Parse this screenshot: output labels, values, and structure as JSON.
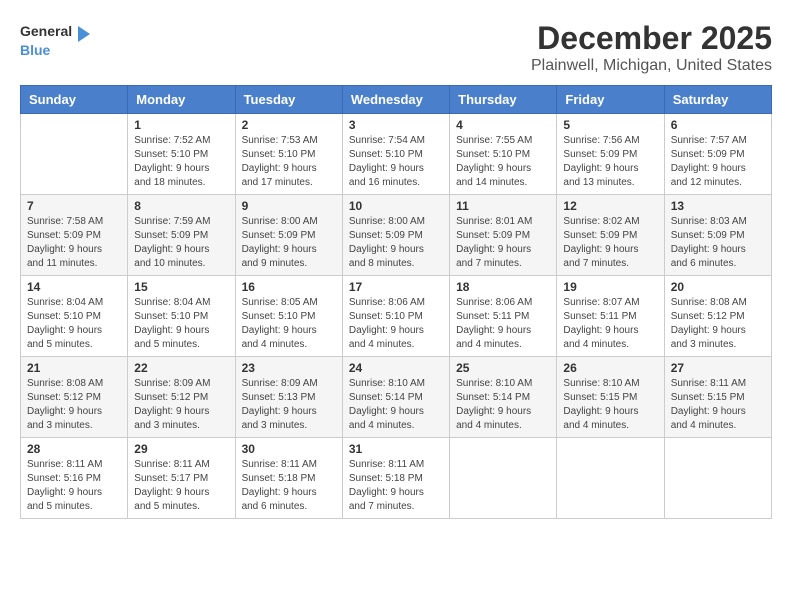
{
  "logo": {
    "text_general": "General",
    "text_blue": "Blue"
  },
  "title": "December 2025",
  "location": "Plainwell, Michigan, United States",
  "weekdays": [
    "Sunday",
    "Monday",
    "Tuesday",
    "Wednesday",
    "Thursday",
    "Friday",
    "Saturday"
  ],
  "weeks": [
    [
      {
        "day": "",
        "info": ""
      },
      {
        "day": "1",
        "info": "Sunrise: 7:52 AM\nSunset: 5:10 PM\nDaylight: 9 hours\nand 18 minutes."
      },
      {
        "day": "2",
        "info": "Sunrise: 7:53 AM\nSunset: 5:10 PM\nDaylight: 9 hours\nand 17 minutes."
      },
      {
        "day": "3",
        "info": "Sunrise: 7:54 AM\nSunset: 5:10 PM\nDaylight: 9 hours\nand 16 minutes."
      },
      {
        "day": "4",
        "info": "Sunrise: 7:55 AM\nSunset: 5:10 PM\nDaylight: 9 hours\nand 14 minutes."
      },
      {
        "day": "5",
        "info": "Sunrise: 7:56 AM\nSunset: 5:09 PM\nDaylight: 9 hours\nand 13 minutes."
      },
      {
        "day": "6",
        "info": "Sunrise: 7:57 AM\nSunset: 5:09 PM\nDaylight: 9 hours\nand 12 minutes."
      }
    ],
    [
      {
        "day": "7",
        "info": "Sunrise: 7:58 AM\nSunset: 5:09 PM\nDaylight: 9 hours\nand 11 minutes."
      },
      {
        "day": "8",
        "info": "Sunrise: 7:59 AM\nSunset: 5:09 PM\nDaylight: 9 hours\nand 10 minutes."
      },
      {
        "day": "9",
        "info": "Sunrise: 8:00 AM\nSunset: 5:09 PM\nDaylight: 9 hours\nand 9 minutes."
      },
      {
        "day": "10",
        "info": "Sunrise: 8:00 AM\nSunset: 5:09 PM\nDaylight: 9 hours\nand 8 minutes."
      },
      {
        "day": "11",
        "info": "Sunrise: 8:01 AM\nSunset: 5:09 PM\nDaylight: 9 hours\nand 7 minutes."
      },
      {
        "day": "12",
        "info": "Sunrise: 8:02 AM\nSunset: 5:09 PM\nDaylight: 9 hours\nand 7 minutes."
      },
      {
        "day": "13",
        "info": "Sunrise: 8:03 AM\nSunset: 5:09 PM\nDaylight: 9 hours\nand 6 minutes."
      }
    ],
    [
      {
        "day": "14",
        "info": "Sunrise: 8:04 AM\nSunset: 5:10 PM\nDaylight: 9 hours\nand 5 minutes."
      },
      {
        "day": "15",
        "info": "Sunrise: 8:04 AM\nSunset: 5:10 PM\nDaylight: 9 hours\nand 5 minutes."
      },
      {
        "day": "16",
        "info": "Sunrise: 8:05 AM\nSunset: 5:10 PM\nDaylight: 9 hours\nand 4 minutes."
      },
      {
        "day": "17",
        "info": "Sunrise: 8:06 AM\nSunset: 5:10 PM\nDaylight: 9 hours\nand 4 minutes."
      },
      {
        "day": "18",
        "info": "Sunrise: 8:06 AM\nSunset: 5:11 PM\nDaylight: 9 hours\nand 4 minutes."
      },
      {
        "day": "19",
        "info": "Sunrise: 8:07 AM\nSunset: 5:11 PM\nDaylight: 9 hours\nand 4 minutes."
      },
      {
        "day": "20",
        "info": "Sunrise: 8:08 AM\nSunset: 5:12 PM\nDaylight: 9 hours\nand 3 minutes."
      }
    ],
    [
      {
        "day": "21",
        "info": "Sunrise: 8:08 AM\nSunset: 5:12 PM\nDaylight: 9 hours\nand 3 minutes."
      },
      {
        "day": "22",
        "info": "Sunrise: 8:09 AM\nSunset: 5:12 PM\nDaylight: 9 hours\nand 3 minutes."
      },
      {
        "day": "23",
        "info": "Sunrise: 8:09 AM\nSunset: 5:13 PM\nDaylight: 9 hours\nand 3 minutes."
      },
      {
        "day": "24",
        "info": "Sunrise: 8:10 AM\nSunset: 5:14 PM\nDaylight: 9 hours\nand 4 minutes."
      },
      {
        "day": "25",
        "info": "Sunrise: 8:10 AM\nSunset: 5:14 PM\nDaylight: 9 hours\nand 4 minutes."
      },
      {
        "day": "26",
        "info": "Sunrise: 8:10 AM\nSunset: 5:15 PM\nDaylight: 9 hours\nand 4 minutes."
      },
      {
        "day": "27",
        "info": "Sunrise: 8:11 AM\nSunset: 5:15 PM\nDaylight: 9 hours\nand 4 minutes."
      }
    ],
    [
      {
        "day": "28",
        "info": "Sunrise: 8:11 AM\nSunset: 5:16 PM\nDaylight: 9 hours\nand 5 minutes."
      },
      {
        "day": "29",
        "info": "Sunrise: 8:11 AM\nSunset: 5:17 PM\nDaylight: 9 hours\nand 5 minutes."
      },
      {
        "day": "30",
        "info": "Sunrise: 8:11 AM\nSunset: 5:18 PM\nDaylight: 9 hours\nand 6 minutes."
      },
      {
        "day": "31",
        "info": "Sunrise: 8:11 AM\nSunset: 5:18 PM\nDaylight: 9 hours\nand 7 minutes."
      },
      {
        "day": "",
        "info": ""
      },
      {
        "day": "",
        "info": ""
      },
      {
        "day": "",
        "info": ""
      }
    ]
  ]
}
